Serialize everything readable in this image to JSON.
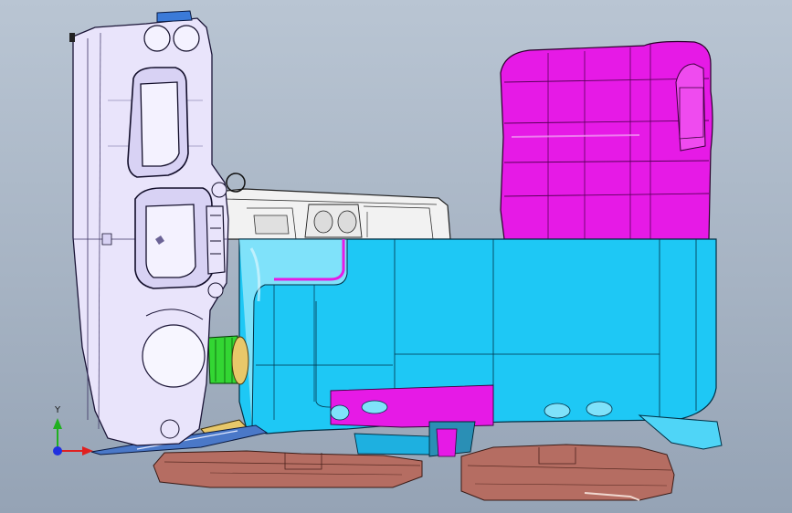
{
  "viewport": {
    "background_top": "#b9c5d3",
    "background_bottom": "#95a3b5"
  },
  "model": {
    "parts": [
      {
        "name": "front-panel",
        "color": "#e9e4fb"
      },
      {
        "name": "cab-frame",
        "color": "#f2f2f2"
      },
      {
        "name": "seat",
        "color": "#e61ae6"
      },
      {
        "name": "body-tub",
        "color": "#1ec8f5"
      },
      {
        "name": "pedal-mount",
        "color": "#33d633"
      },
      {
        "name": "bracket",
        "color": "#e8c86a"
      },
      {
        "name": "base-plates",
        "color": "#b56d62"
      }
    ]
  },
  "triad": {
    "y_label": "Y",
    "x_axis_color": "#e02020",
    "y_axis_color": "#20b020",
    "z_axis_color": "#2030e0"
  }
}
